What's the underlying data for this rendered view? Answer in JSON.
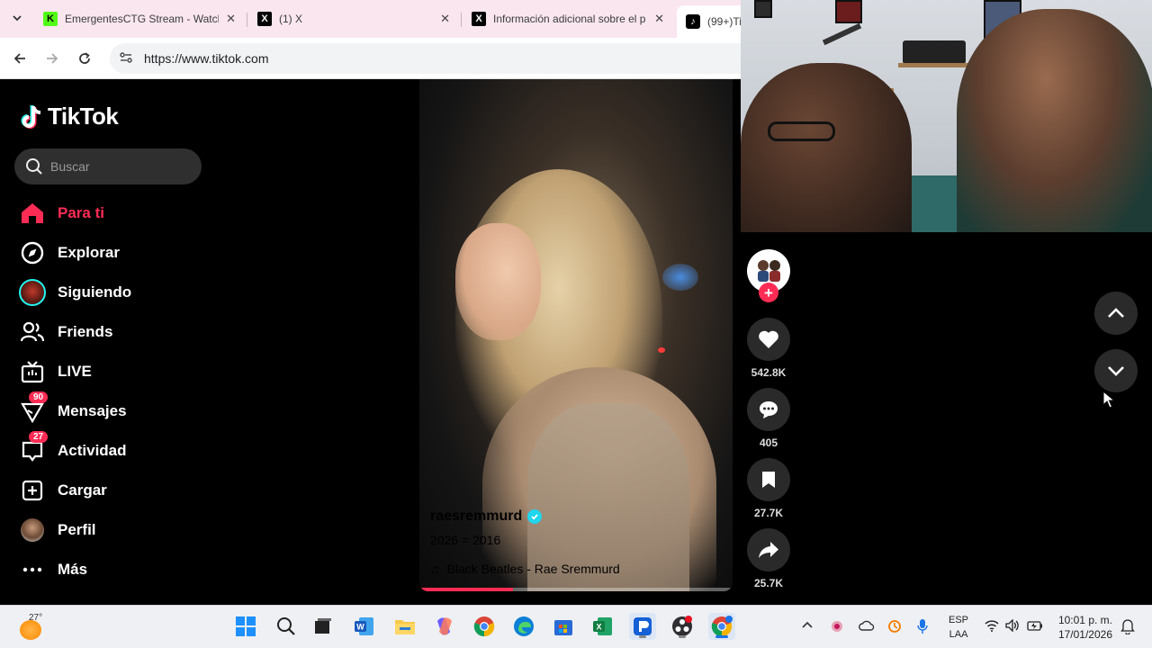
{
  "browser": {
    "tabs": [
      {
        "title": "EmergentesCTG Stream - Watch",
        "favicon": "kick-icon",
        "close": "✕"
      },
      {
        "title": "(1) X",
        "favicon": "x-icon",
        "close": "✕"
      },
      {
        "title": "Información adicional sobre el p",
        "favicon": "x-icon",
        "close": "✕"
      },
      {
        "title": "(99+)Ti",
        "favicon": "tiktok-icon",
        "active": true
      }
    ],
    "url": "https://www.tiktok.com"
  },
  "tiktok": {
    "logo_text": "TikTok",
    "search_placeholder": "Buscar",
    "nav": [
      {
        "label": "Para ti",
        "icon": "home-icon",
        "active": true
      },
      {
        "label": "Explorar",
        "icon": "compass-icon"
      },
      {
        "label": "Siguiendo",
        "icon": "following-avatar-icon"
      },
      {
        "label": "Friends",
        "icon": "friends-icon"
      },
      {
        "label": "LIVE",
        "icon": "live-tv-icon"
      },
      {
        "label": "Mensajes",
        "icon": "messages-icon",
        "badge": "90"
      },
      {
        "label": "Actividad",
        "icon": "activity-icon",
        "badge": "27"
      },
      {
        "label": "Cargar",
        "icon": "upload-icon"
      },
      {
        "label": "Perfil",
        "icon": "profile-avatar-icon"
      },
      {
        "label": "Más",
        "icon": "more-icon"
      }
    ],
    "video": {
      "username": "raesremmurd",
      "verified": true,
      "caption": "2026 = 2016",
      "music": "Black Beatles - Rae Sremmurd",
      "progress": 0.3
    },
    "actions": {
      "likes": "542.8K",
      "comments": "405",
      "saves": "27.7K",
      "shares": "25.7K",
      "follow_symbol": "+"
    },
    "colors": {
      "accent": "#fe2c55",
      "verified": "#20d5ec"
    }
  },
  "taskbar": {
    "weather_temp": "27°",
    "apps": [
      "start-icon",
      "search-icon",
      "task-view-icon",
      "word-icon",
      "file-explorer-icon",
      "copilot-icon",
      "chrome-icon",
      "edge-icon",
      "store-icon",
      "excel-icon",
      "app-icon",
      "obs-icon",
      "chrome-profile-icon"
    ],
    "language_top": "ESP",
    "language_bottom": "LAA",
    "time": "10:01 p. m.",
    "date": "17/01/2026"
  }
}
